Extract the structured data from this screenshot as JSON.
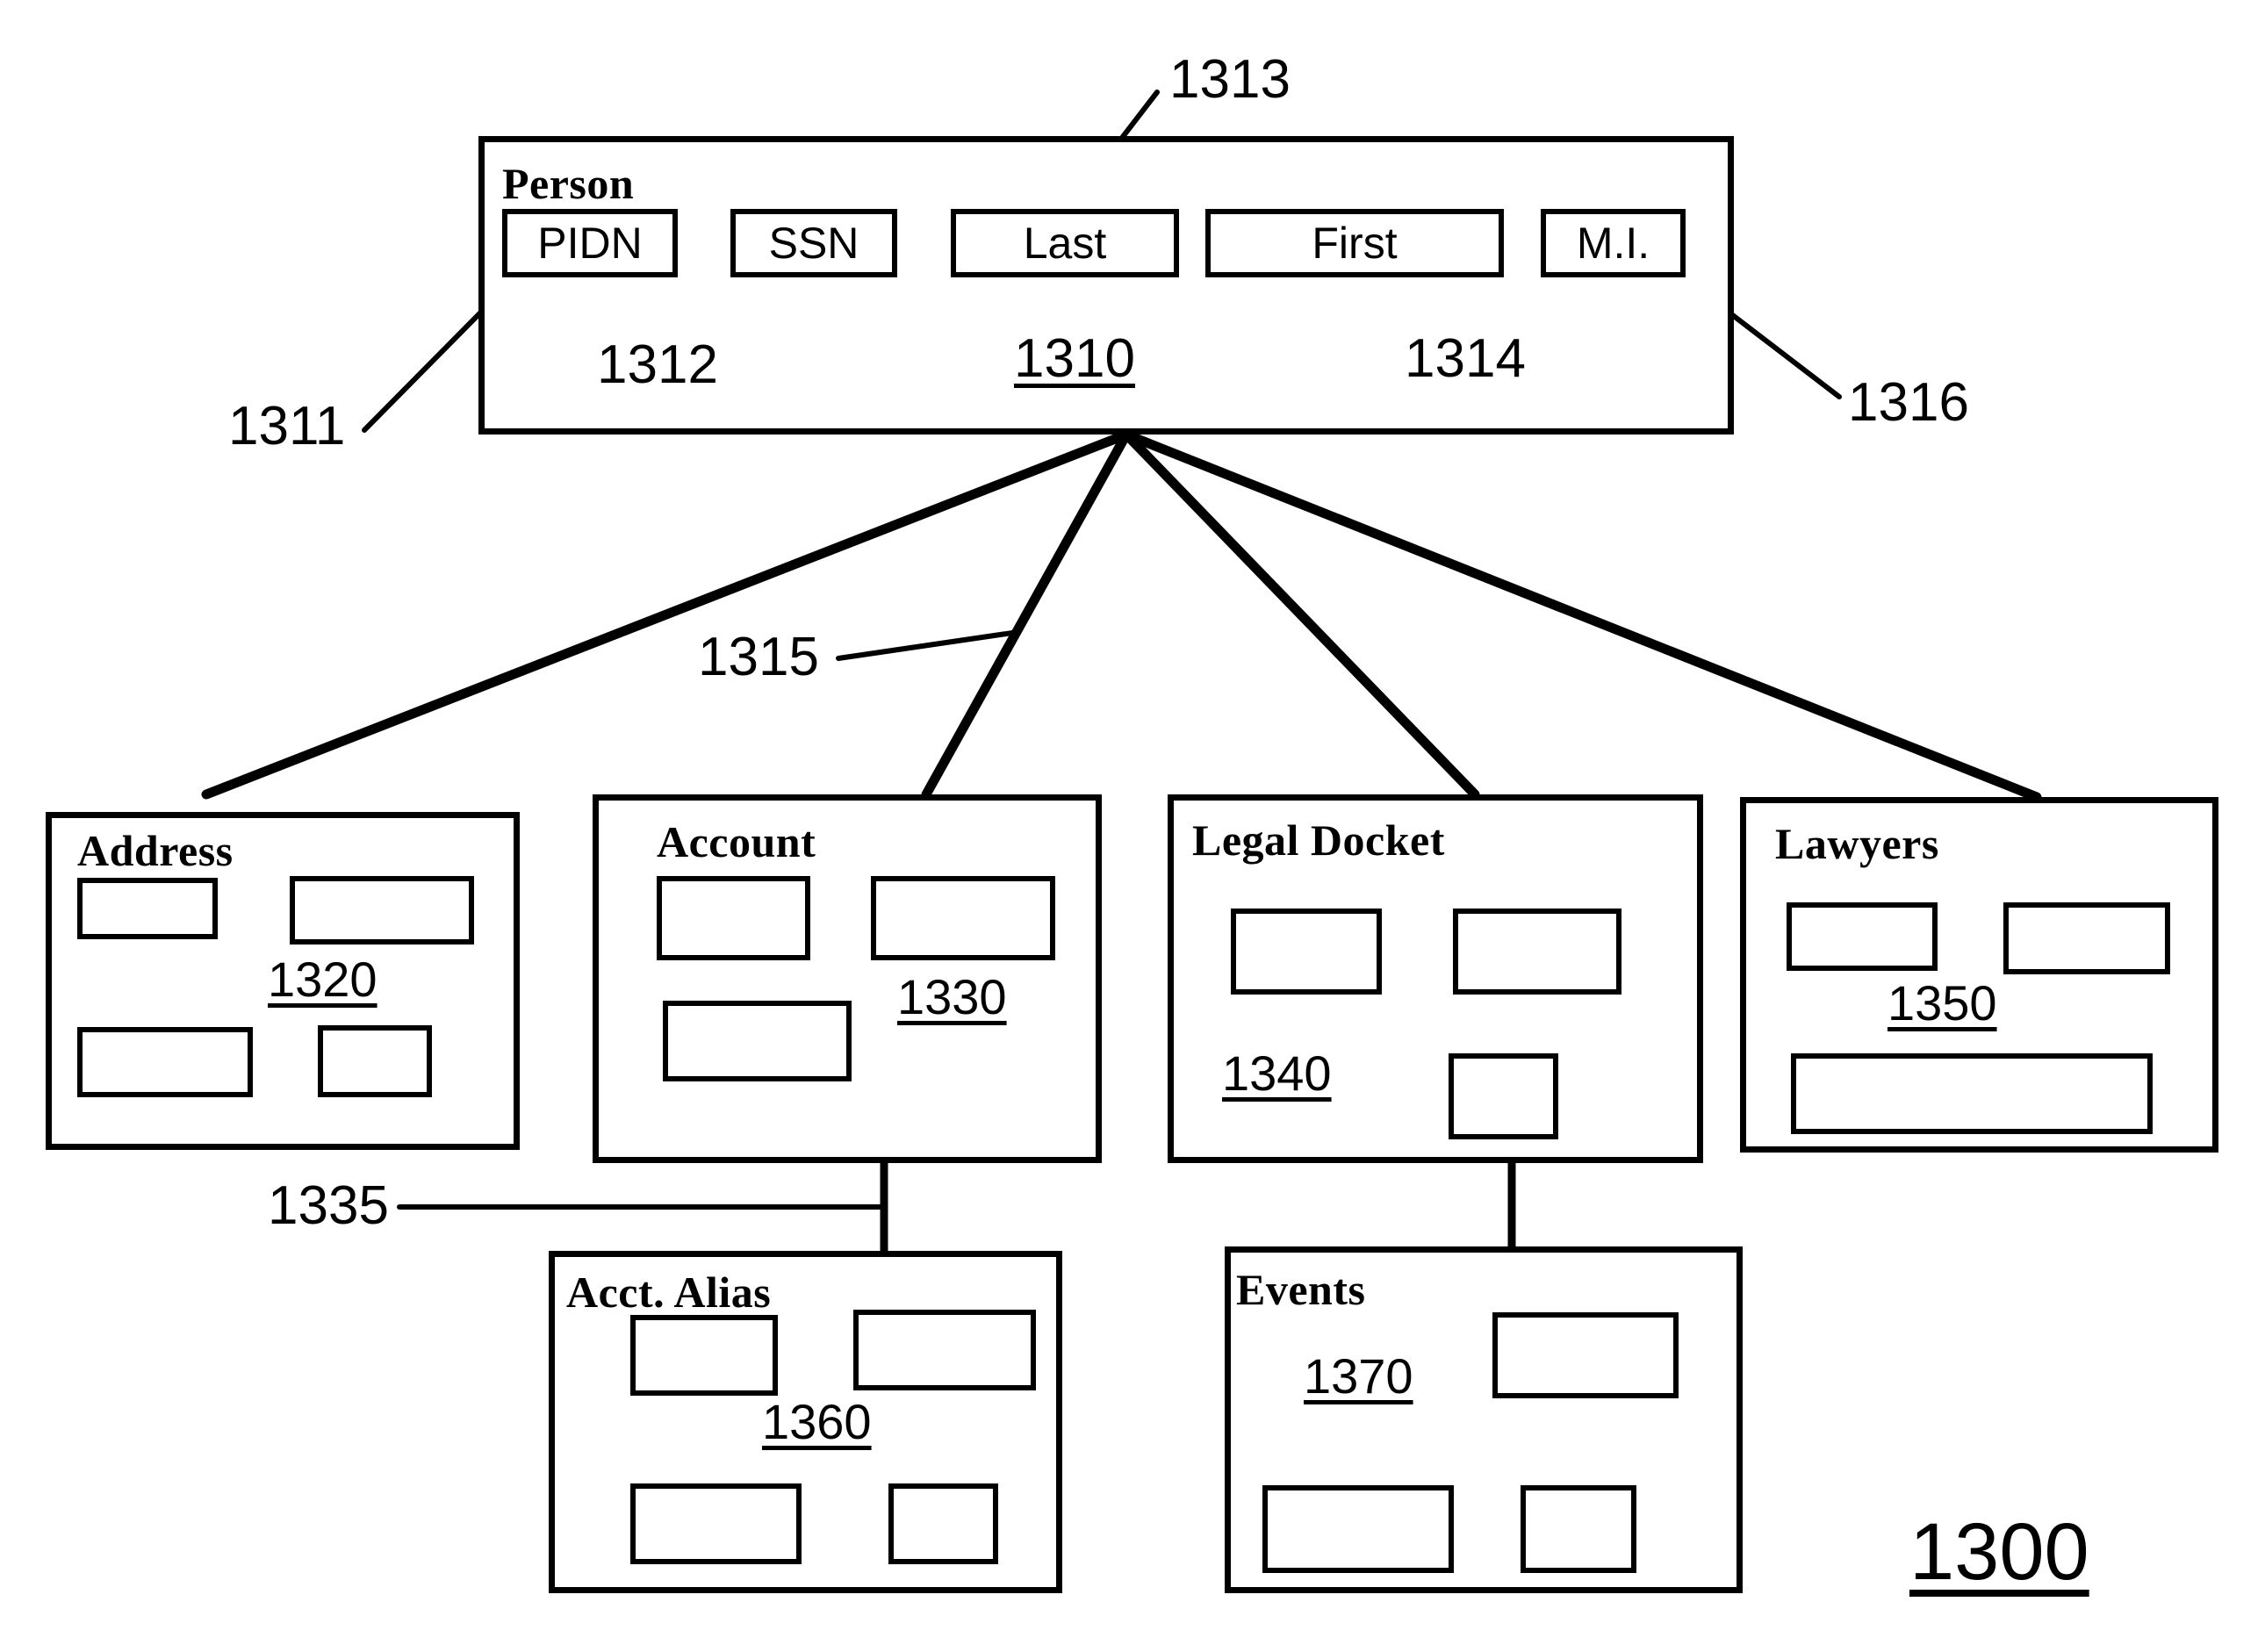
{
  "figure": {
    "number": "1300",
    "type": "entity-relationship-diagram"
  },
  "person": {
    "title": "Person",
    "ref": "1310",
    "fields": [
      {
        "label": "PIDN",
        "ref": "1311"
      },
      {
        "label": "SSN",
        "ref": "1312"
      },
      {
        "label": "Last",
        "ref": "1313"
      },
      {
        "label": "First",
        "ref": "1314"
      },
      {
        "label": "M.I.",
        "ref": "1316"
      }
    ]
  },
  "relationships": {
    "person_children_ref": "1315",
    "account_alias_ref": "1335"
  },
  "entities": [
    {
      "title": "Address",
      "ref": "1320",
      "attribute_count": 4
    },
    {
      "title": "Account",
      "ref": "1330",
      "attribute_count": 3
    },
    {
      "title": "Legal Docket",
      "ref": "1340",
      "attribute_count": 3
    },
    {
      "title": "Lawyers",
      "ref": "1350",
      "attribute_count": 3
    },
    {
      "title": "Acct. Alias",
      "ref": "1360",
      "attribute_count": 4
    },
    {
      "title": "Events",
      "ref": "1370",
      "attribute_count": 3
    }
  ],
  "colors": {
    "ink": "#000000",
    "paper": "#ffffff"
  }
}
